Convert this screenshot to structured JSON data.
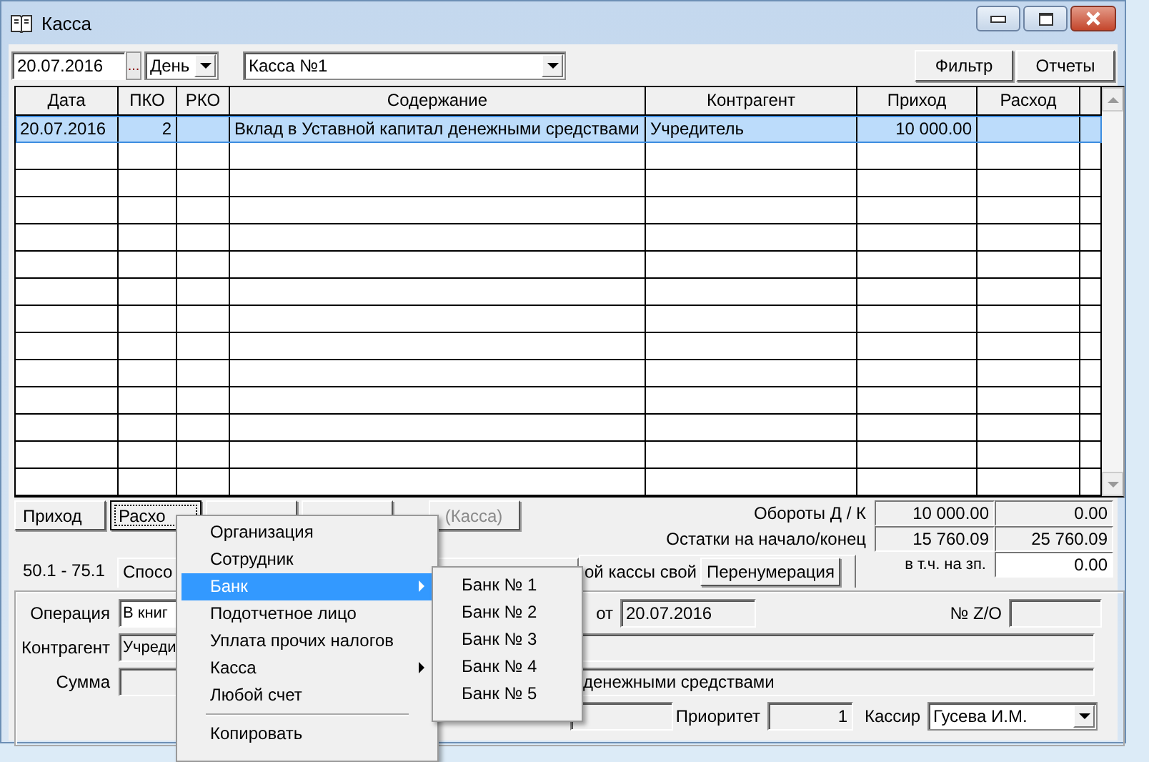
{
  "window": {
    "title": "Касса"
  },
  "toolbar": {
    "date": "20.07.2016",
    "date_button": "...",
    "period": "День",
    "cashbox": "Касса №1",
    "buttons": [
      "Фильтр",
      "Отчеты"
    ]
  },
  "table": {
    "columns": [
      "Дата",
      "ПКО",
      "РКО",
      "Содержание",
      "Контрагент",
      "Приход",
      "Расход"
    ],
    "rows": [
      {
        "date": "20.07.2016",
        "pko": "2",
        "content": "Вклад в Уставной капитал денежными средствами",
        "counterparty": "Учредитель",
        "income": "10 000.00",
        "selected": true
      }
    ]
  },
  "actions": [
    {
      "label": "Приход",
      "focused": false,
      "disabled": false
    },
    {
      "label": "Расхо",
      "focused": true,
      "disabled": false
    },
    {
      "focused": false
    },
    {
      "focused": false
    },
    {
      "label": "(Касса)",
      "focused": false,
      "disabled": true
    }
  ],
  "totals": {
    "turnover_label": "Обороты Д / К",
    "turnover": [
      "10 000.00",
      "0.00"
    ],
    "balance_label": "Остатки на начало/конец",
    "balance": [
      "15 760.09",
      "25 760.09"
    ],
    "salary_label": "в т.ч. на зп.",
    "salary": "0.00"
  },
  "accounts": "50.1 - 75.1",
  "tabs": [
    "Спосо",
    "ой кассы свой"
  ],
  "renumber_button": "Перенумерация",
  "form": {
    "operation_label": "Операция",
    "operation": "В книг",
    "date_label": "от",
    "date": "20.07.2016",
    "zo_label": "№ Z/O",
    "counterparty_label": "Контрагент",
    "counterparty": "Учреди",
    "sum_label": "Сумма",
    "content": "денежными средствами",
    "priority_label": "Приоритет",
    "priority": "1",
    "cashier_label": "Кассир",
    "cashier": "Гусева И.М."
  },
  "context_menu": {
    "items": [
      {
        "kind": "item",
        "label": "Организация",
        "selected": false,
        "submenu": false
      },
      {
        "kind": "item",
        "label": "Сотрудник",
        "selected": false,
        "submenu": false
      },
      {
        "kind": "item",
        "label": "Банк",
        "selected": true,
        "submenu": true
      },
      {
        "kind": "item",
        "label": "Подотчетное лицо",
        "selected": false,
        "submenu": false
      },
      {
        "kind": "item",
        "label": "Уплата прочих налогов",
        "selected": false,
        "submenu": false
      },
      {
        "kind": "item",
        "label": "Касса",
        "selected": false,
        "submenu": true
      },
      {
        "kind": "item",
        "label": "Любой счет",
        "selected": false,
        "submenu": false
      },
      {
        "kind": "separator"
      },
      {
        "kind": "item",
        "label": "Копировать",
        "selected": false,
        "submenu": false
      }
    ]
  },
  "submenu": {
    "items": [
      "Банк № 1",
      "Банк № 2",
      "Банк № 3",
      "Банк № 4",
      "Банк № 5"
    ]
  }
}
